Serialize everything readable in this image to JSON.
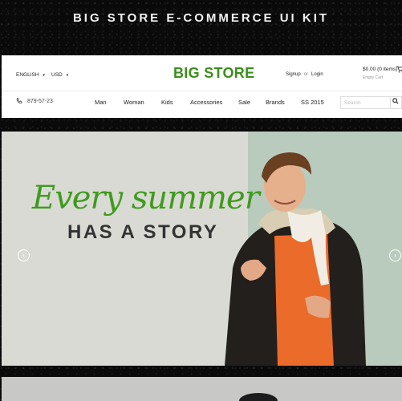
{
  "kit_title": "BIG STORE E-COMMERCE UI KIT",
  "topbar": {
    "language": "ENGLISH",
    "currency": "USD",
    "brand": "BIG STORE",
    "signup": "Signup",
    "or": "or",
    "login": "Login",
    "cart_total": "$0.00 (0 items)",
    "cart_empty": "Empty Cart",
    "caret": "▾"
  },
  "navbar": {
    "phone": "879-57-23",
    "items": [
      "Man",
      "Woman",
      "Kids",
      "Accessories",
      "Sale",
      "Brands",
      "SS 2015"
    ],
    "search_placeholder": "Search"
  },
  "hero": {
    "line1": "Every summer",
    "line2": "HAS A STORY",
    "prev": "‹",
    "next": "›"
  },
  "colors": {
    "brand_green": "#3b8f1b",
    "hero_bg": "#dadad4",
    "hero_right_bg": "#b9cbbd"
  },
  "icons": [
    "phone-icon",
    "search-icon",
    "cart-icon",
    "chevron-left-icon",
    "chevron-right-icon"
  ]
}
